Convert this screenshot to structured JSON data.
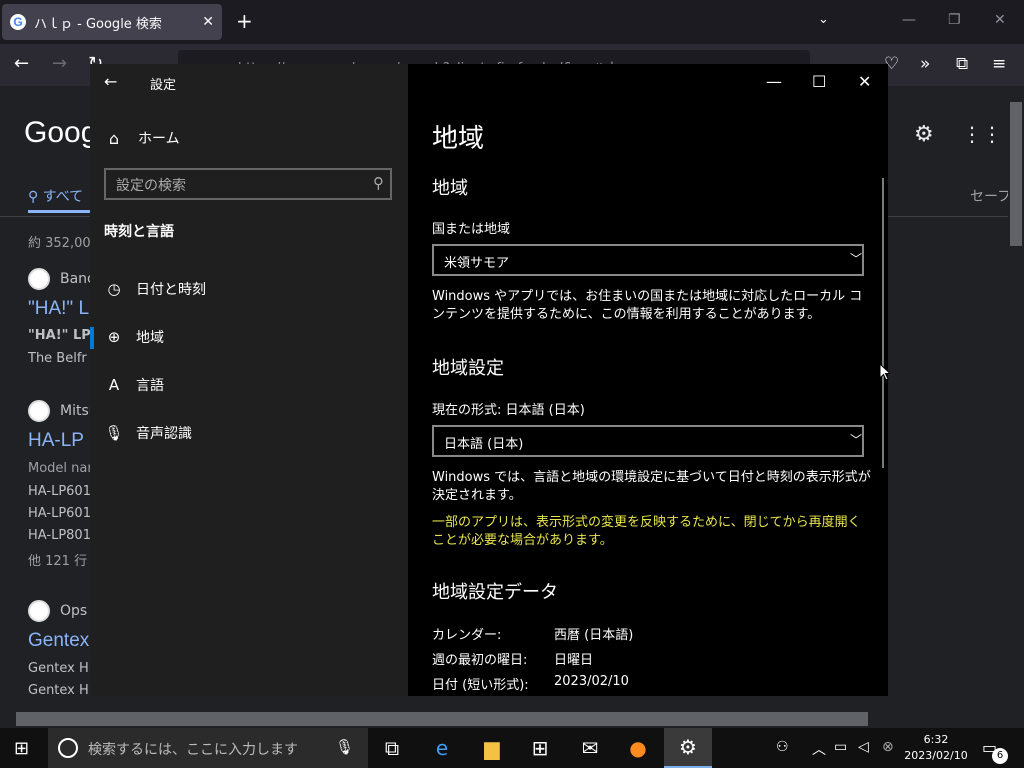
{
  "browser": {
    "tab_title": "ハｌｐ - Google 検索",
    "tab_close": "✕",
    "new_tab": "+",
    "url": "https://www.google.com/search?client=firefox-b-d&q=ハｌｐ",
    "window_controls": {
      "minimize": "—",
      "restore": "❐",
      "close": "✕"
    }
  },
  "google": {
    "logo": "Goog",
    "tab_all": "すべて",
    "result_count": "約 352,00",
    "safe_search": "セーフ",
    "results": [
      {
        "site": "Banc",
        "title": "\"HA!\" L",
        "snippet": [
          "\"HA!\" LP",
          "The Belfr"
        ]
      },
      {
        "site": "Mitsu",
        "title": "HA-LP",
        "snippet": [
          "Model nar",
          "HA-LP601",
          "HA-LP601",
          "HA-LP801",
          "他 121 行"
        ]
      },
      {
        "site": "Ops",
        "title": "Gentex",
        "snippet": [
          "Gentex Hi",
          "Gentex Hi"
        ]
      }
    ]
  },
  "settings": {
    "app_title": "設定",
    "home": "ホーム",
    "search_placeholder": "設定の検索",
    "section": "時刻と言語",
    "nav": [
      {
        "label": "日付と時刻",
        "active": false
      },
      {
        "label": "地域",
        "active": true
      },
      {
        "label": "言語",
        "active": false
      },
      {
        "label": "音声認識",
        "active": false
      }
    ],
    "content": {
      "page_title": "地域",
      "region_heading": "地域",
      "country_label": "国または地域",
      "country_value": "米領サモア",
      "country_desc": "Windows やアプリでは、お住まいの国または地域に対応したローカル コンテンツを提供するために、この情報を利用することがあります。",
      "format_heading": "地域設定",
      "format_label": "現在の形式: 日本語 (日本)",
      "format_value": "日本語 (日本)",
      "format_desc": "Windows では、言語と地域の環境設定に基づいて日付と時刻の表示形式が決定されます。",
      "format_warning": "一部のアプリは、表示形式の変更を反映するために、閉じてから再度開くことが必要な場合があります。",
      "data_heading": "地域設定データ",
      "data_rows": [
        {
          "key": "カレンダー:",
          "value": "西暦 (日本語)"
        },
        {
          "key": "週の最初の曜日:",
          "value": "日曜日"
        },
        {
          "key": "日付 (短い形式):",
          "value": "2023/02/10"
        }
      ]
    }
  },
  "taskbar": {
    "search_placeholder": "検索するには、ここに入力します",
    "time": "6:32",
    "date": "2023/02/10",
    "notification_count": "6"
  }
}
